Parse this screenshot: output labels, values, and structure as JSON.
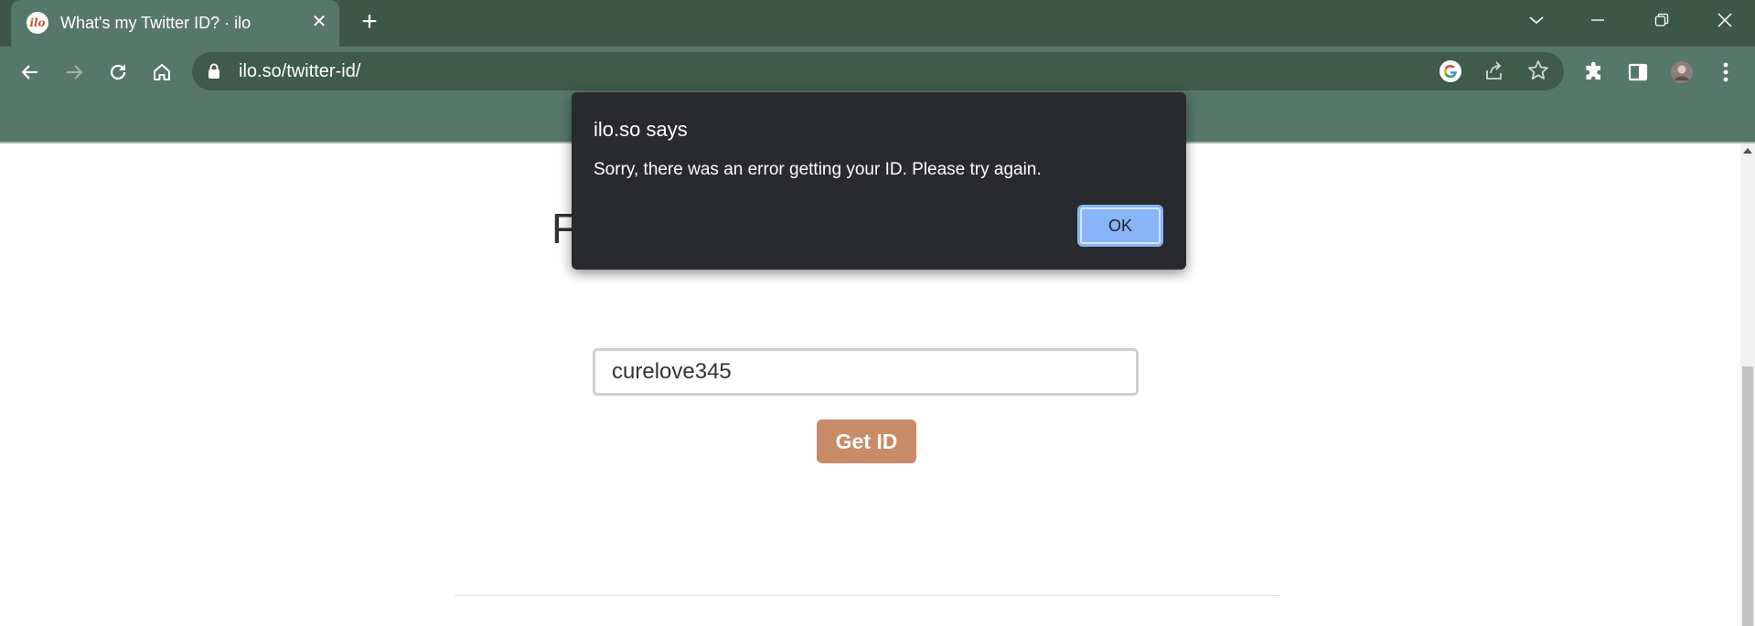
{
  "browser": {
    "tab": {
      "title": "What's my Twitter ID? · ilo",
      "favicon_text": "ilo",
      "close_glyph": "✕"
    },
    "new_tab_glyph": "+",
    "url": "ilo.so/twitter-id/"
  },
  "page": {
    "heading_fragment": "F",
    "username_input_value": "curelove345",
    "get_id_label": "Get ID"
  },
  "dialog": {
    "title": "ilo.so says",
    "message": "Sorry, there was an error getting your ID. Please try again.",
    "ok_label": "OK"
  },
  "colors": {
    "titlebar": "#3d5849",
    "toolbar": "#56786a",
    "omnibox": "#3e5b4c",
    "dialog_bg": "#292a2d",
    "ok_button": "#8ab4f8",
    "get_id_button": "#c98c68"
  },
  "icons": {
    "titlebar": [
      "tab-search-icon",
      "minimize-icon",
      "restore-icon",
      "close-window-icon"
    ],
    "toolbar": [
      "back-icon",
      "forward-icon",
      "reload-icon",
      "home-icon",
      "lock-icon",
      "google-icon",
      "share-icon",
      "star-icon",
      "extensions-icon",
      "side-panel-icon",
      "avatar",
      "menu-icon"
    ]
  }
}
